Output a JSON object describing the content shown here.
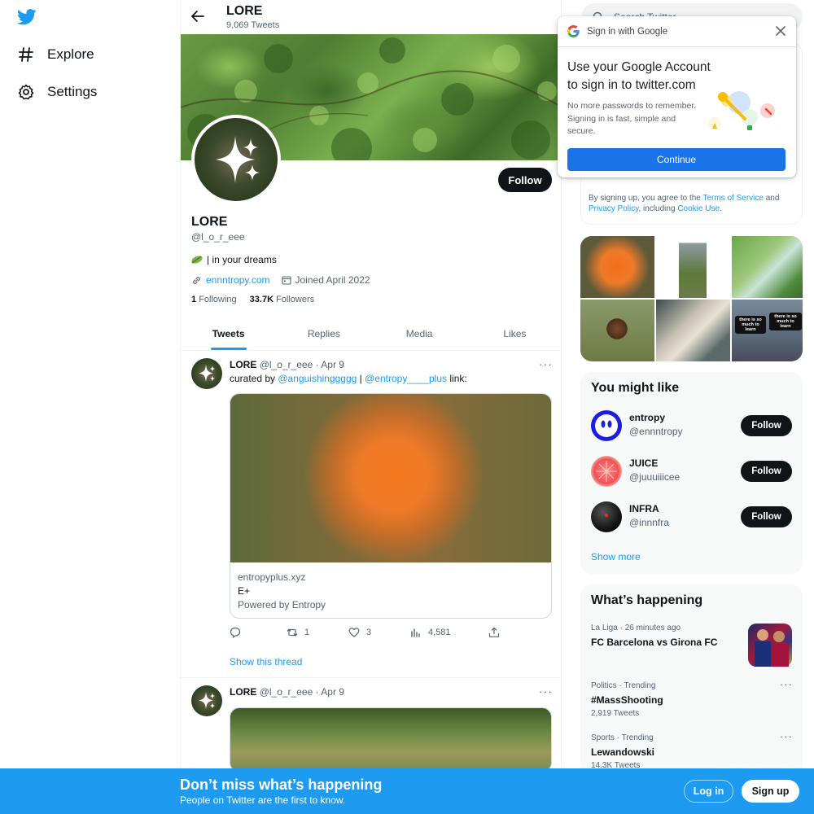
{
  "nav": {
    "logo_icon": "twitter-bird-icon",
    "items": [
      {
        "label": "Explore",
        "icon": "hashtag-icon"
      },
      {
        "label": "Settings",
        "icon": "gear-icon"
      }
    ]
  },
  "header": {
    "title": "LORE",
    "tweet_count": "9,069 Tweets"
  },
  "profile": {
    "follow_label": "Follow",
    "name": "LORE",
    "handle": "@l_o_r_eee",
    "bio": "| in your dreams",
    "website": "ennntropy.com",
    "joined": "Joined April 2022",
    "following_count": "1",
    "following_label": "Following",
    "followers_count": "33.7K",
    "followers_label": "Followers"
  },
  "tabs": [
    "Tweets",
    "Replies",
    "Media",
    "Likes"
  ],
  "tweets": [
    {
      "name": "LORE",
      "handle": "@l_o_r_eee",
      "date": "· Apr 9",
      "text_prefix": "curated by ",
      "mention1": "@anguishinggggg",
      "separator": " | ",
      "mention2": "@entropy____plus",
      "text_suffix": " link:",
      "card": {
        "domain": "entropyplus.xyz",
        "title": "E+",
        "description": "Powered by Entropy"
      },
      "actions": {
        "replies": "",
        "retweets": "1",
        "likes": "3",
        "views": "4,581"
      },
      "show_thread": "Show this thread"
    },
    {
      "name": "LORE",
      "handle": "@l_o_r_eee",
      "date": "· Apr 9"
    }
  ],
  "search": {
    "placeholder": "Search Twitter"
  },
  "google_signin": {
    "header": "Sign in with Google",
    "title": "Use your Google Account to sign in to twitter.com",
    "subtitle": "No more passwords to remember. Signing in is fast, simple and secure.",
    "continue_label": "Continue"
  },
  "terms": {
    "prefix": "By signing up, you agree to the ",
    "tos": "Terms of Service",
    "and": " and ",
    "privacy": "Privacy Policy",
    "including": ", including ",
    "cookie": "Cookie Use",
    "end": "."
  },
  "media_captions": [
    "there is so much to learn",
    "there is so much to learn"
  ],
  "you_might_like": {
    "title": "You might like",
    "suggestions": [
      {
        "name": "entropy",
        "handle": "@ennntropy",
        "follow_label": "Follow"
      },
      {
        "name": "JUICE",
        "handle": "@juuuiiicee",
        "follow_label": "Follow"
      },
      {
        "name": "INFRA",
        "handle": "@innnfra",
        "follow_label": "Follow"
      }
    ],
    "show_more": "Show more"
  },
  "whats_happening": {
    "title": "What’s happening",
    "trends": [
      {
        "meta": "La Liga · 26 minutes ago",
        "name": "FC Barcelona vs Girona FC",
        "count": ""
      },
      {
        "meta": "Politics · Trending",
        "name": "#MassShooting",
        "count": "2,919 Tweets"
      },
      {
        "meta": "Sports · Trending",
        "name": "Lewandowski",
        "count": "14.3K Tweets"
      }
    ]
  },
  "bottom_bar": {
    "title": "Don’t miss what’s happening",
    "subtitle": "People on Twitter are the first to know.",
    "login_label": "Log in",
    "signup_label": "Sign up"
  },
  "colors": {
    "accent": "#1d9bf0",
    "text": "#0f1419",
    "muted": "#536471",
    "google_blue": "#1a73e8"
  }
}
